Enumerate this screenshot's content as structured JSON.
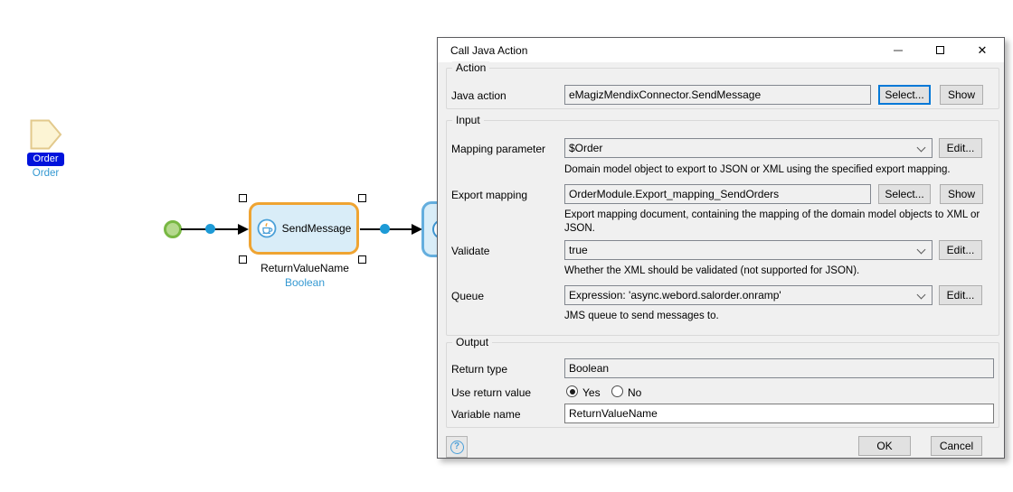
{
  "canvas": {
    "parameter": {
      "name": "Order",
      "entity": "Order"
    },
    "activity": {
      "label": "SendMessage",
      "variable": "ReturnValueName",
      "return_type": "Boolean"
    }
  },
  "dialog": {
    "title": "Call Java Action",
    "action_group": {
      "label": "Action",
      "java_action_label": "Java action",
      "java_action_value": "eMagizMendixConnector.SendMessage",
      "select_label": "Select...",
      "show_label": "Show"
    },
    "input_group": {
      "label": "Input",
      "rows": [
        {
          "label": "Mapping parameter",
          "value": "$Order",
          "edit_label": "Edit...",
          "description": "Domain model object to export to JSON or XML using the specified export mapping."
        },
        {
          "label": "Export mapping",
          "value": "OrderModule.Export_mapping_SendOrders",
          "select_label": "Select...",
          "show_label": "Show",
          "description": "Export mapping document, containing the mapping of the domain model objects to XML or JSON."
        },
        {
          "label": "Validate",
          "value": "true",
          "edit_label": "Edit...",
          "description": "Whether the XML should be validated (not supported for JSON)."
        },
        {
          "label": "Queue",
          "value": "Expression: 'async.webord.salorder.onramp'",
          "edit_label": "Edit...",
          "description": "JMS queue to send messages to."
        }
      ]
    },
    "output_group": {
      "label": "Output",
      "return_type_label": "Return type",
      "return_type_value": "Boolean",
      "use_return_label": "Use return value",
      "radio_yes": "Yes",
      "radio_no": "No",
      "variable_label": "Variable name",
      "variable_value": "ReturnValueName"
    },
    "footer": {
      "ok_label": "OK",
      "cancel_label": "Cancel"
    }
  },
  "icons": {
    "close_glyph": "✕",
    "help_glyph": "?"
  },
  "colors": {
    "selected_activity_border": "#efa432",
    "activity_fill": "#d9edf8",
    "activity_border": "#64aede",
    "start_event_fill": "#b5d98e",
    "start_event_border": "#78b843",
    "flow_dot": "#1d9ad6",
    "selection_pill": "#0013dc",
    "type_text": "#3599d2",
    "focus_border": "#0078d7"
  }
}
